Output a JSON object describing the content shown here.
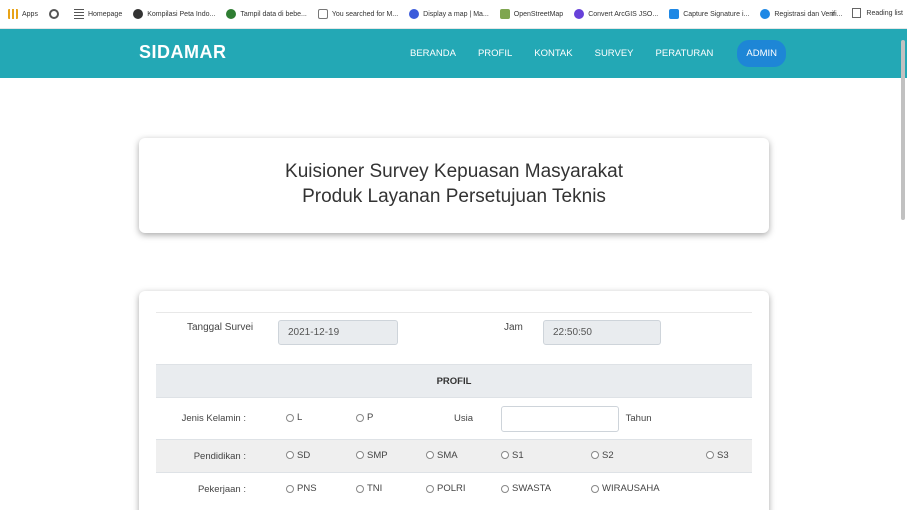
{
  "bookmarks": {
    "items": [
      {
        "label": "Apps",
        "icon": "apps-grid-icon",
        "color": "#e8a317"
      },
      {
        "label": "",
        "icon": "chrome-icon",
        "color": "#555555"
      },
      {
        "label": "Homepage",
        "icon": "list-icon",
        "color": "#555555"
      },
      {
        "label": "Kompilasi Peta Indo...",
        "icon": "site-icon",
        "color": "#333333"
      },
      {
        "label": "Tampil data di bebe...",
        "icon": "site-icon",
        "color": "#2e7d32"
      },
      {
        "label": "You searched for M...",
        "icon": "code-icon",
        "color": "#555555"
      },
      {
        "label": "Display a map | Ma...",
        "icon": "site-icon",
        "color": "#3b5bdb"
      },
      {
        "label": "OpenStreetMap",
        "icon": "osm-icon",
        "color": "#7fa650"
      },
      {
        "label": "Convert ArcGIS JSO...",
        "icon": "site-icon",
        "color": "#6741d9"
      },
      {
        "label": "Capture Signature i...",
        "icon": "site-icon",
        "color": "#1e88e5"
      },
      {
        "label": "Registrasi dan Verifi...",
        "icon": "site-icon",
        "color": "#1e88e5"
      }
    ],
    "more": "»",
    "reading_list": "Reading list"
  },
  "navbar": {
    "brand": "SIDAMAR",
    "items": [
      "BERANDA",
      "PROFIL",
      "KONTAK",
      "SURVEY",
      "PERATURAN"
    ],
    "admin": "ADMIN",
    "bg_color": "#23a8b5",
    "admin_color": "#1e86d6"
  },
  "title_card": {
    "line1": "Kuisioner Survey Kepuasan Masyarakat",
    "line2": "Produk Layanan Persetujuan Teknis"
  },
  "form": {
    "date_label": "Tanggal Survei",
    "date_value": "2021-12-19",
    "time_label": "Jam",
    "time_value": "22:50:50",
    "section_title": "PROFIL",
    "gender_label": "Jenis Kelamin :",
    "gender_options": [
      "L",
      "P"
    ],
    "age_label": "Usia",
    "age_value": "",
    "age_unit": "Tahun",
    "education_label": "Pendidikan :",
    "education_options": [
      "SD",
      "SMP",
      "SMA",
      "S1",
      "S2",
      "S3"
    ],
    "job_label": "Pekerjaan :",
    "job_options": [
      "PNS",
      "TNI",
      "POLRI",
      "SWASTA",
      "WIRAUSAHA"
    ]
  }
}
